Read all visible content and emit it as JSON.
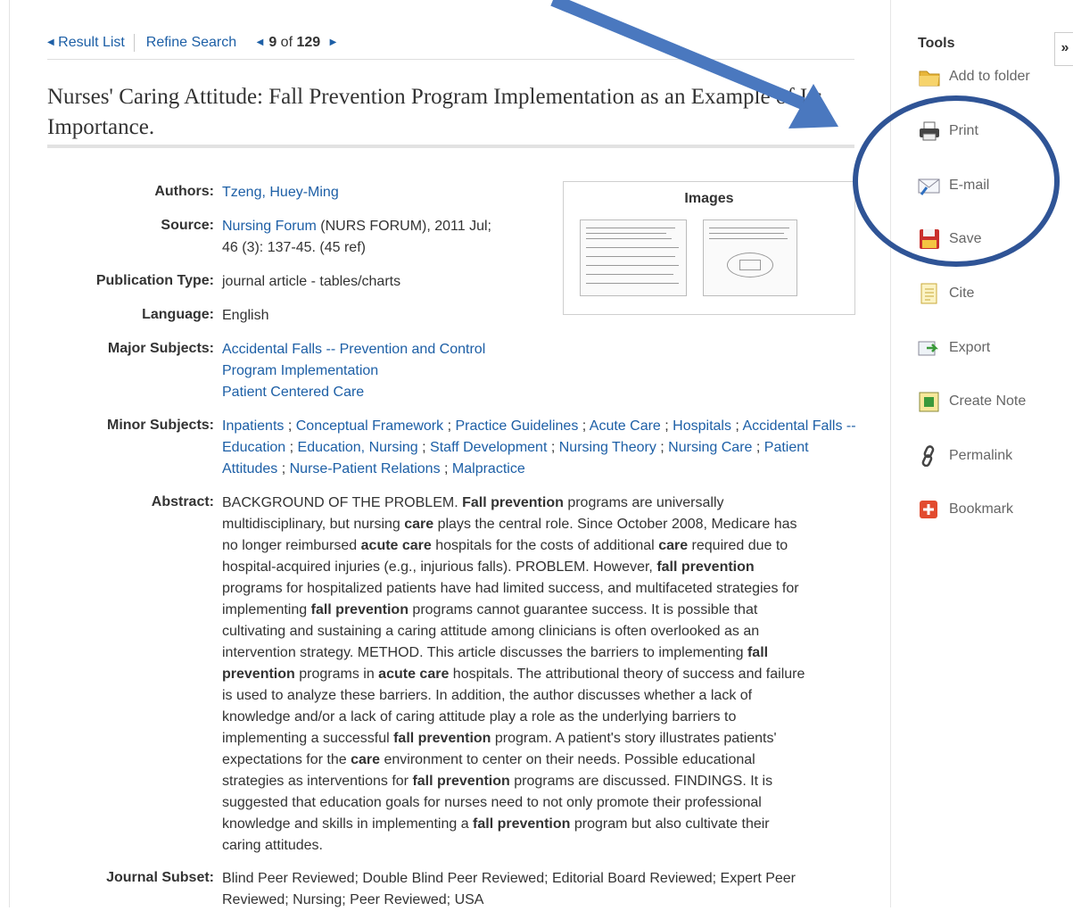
{
  "nav": {
    "result_list": "Result List",
    "refine_search": "Refine Search",
    "position": "9",
    "of_label": "of",
    "total": "129"
  },
  "article": {
    "title": "Nurses' Caring Attitude: Fall Prevention Program Implementation as an Example of Its Importance."
  },
  "fields": {
    "authors_label": "Authors:",
    "authors": "Tzeng, Huey-Ming",
    "source_label": "Source:",
    "source_link": "Nursing Forum",
    "source_rest": " (NURS FORUM), 2011 Jul;",
    "source_line2": "46 (3): 137-45. (45 ref)",
    "pubtype_label": "Publication Type:",
    "pubtype": "journal article - tables/charts",
    "language_label": "Language:",
    "language": "English",
    "major_label": "Major Subjects:",
    "major": [
      "Accidental Falls -- Prevention and Control",
      "Program Implementation",
      "Patient Centered Care"
    ],
    "minor_label": "Minor Subjects:",
    "minor": [
      "Inpatients",
      "Conceptual Framework",
      "Practice Guidelines",
      "Acute Care",
      "Hospitals",
      "Accidental Falls -- Education",
      "Education, Nursing",
      "Staff Development",
      "Nursing Theory",
      "Nursing Care",
      "Patient Attitudes",
      "Nurse-Patient Relations",
      "Malpractice"
    ],
    "abstract_label": "Abstract:",
    "journal_subset_label": "Journal Subset:",
    "journal_subset": "Blind Peer Reviewed; Double Blind Peer Reviewed; Editorial Board Reviewed; Expert Peer Reviewed; Nursing; Peer Reviewed; USA"
  },
  "abstract_lines": [
    [
      [
        "BACKGROUND OF THE PROBLEM. ",
        false
      ],
      [
        "Fall prevention",
        true
      ],
      [
        " programs are universally",
        false
      ]
    ],
    [
      [
        "multidisciplinary, but nursing ",
        false
      ],
      [
        "care",
        true
      ],
      [
        " plays the central role. Since October 2008, Medicare has",
        false
      ]
    ],
    [
      [
        "no longer reimbursed ",
        false
      ],
      [
        "acute care",
        true
      ],
      [
        " hospitals for the costs of additional ",
        false
      ],
      [
        "care",
        true
      ],
      [
        " required due to",
        false
      ]
    ],
    [
      [
        "hospital-acquired injuries (e.g., injurious falls). PROBLEM. However, ",
        false
      ],
      [
        "fall prevention",
        true
      ]
    ],
    [
      [
        "programs for hospitalized patients have had limited success, and multifaceted strategies for",
        false
      ]
    ],
    [
      [
        "implementing ",
        false
      ],
      [
        "fall prevention",
        true
      ],
      [
        " programs cannot guarantee success. It is possible that",
        false
      ]
    ],
    [
      [
        "cultivating and sustaining a caring attitude among clinicians is often overlooked as an",
        false
      ]
    ],
    [
      [
        "intervention strategy. METHOD. This article discusses the barriers to implementing ",
        false
      ],
      [
        "fall",
        true
      ]
    ],
    [
      [
        "prevention",
        true
      ],
      [
        " programs in ",
        false
      ],
      [
        "acute care",
        true
      ],
      [
        " hospitals. The attributional theory of success and failure",
        false
      ]
    ],
    [
      [
        "is used to analyze these barriers. In addition, the author discusses whether a lack of",
        false
      ]
    ],
    [
      [
        "knowledge and/or a lack of caring attitude play a role as the underlying barriers to",
        false
      ]
    ],
    [
      [
        "implementing a successful ",
        false
      ],
      [
        "fall prevention",
        true
      ],
      [
        " program. A patient's story illustrates patients'",
        false
      ]
    ],
    [
      [
        "expectations for the ",
        false
      ],
      [
        "care",
        true
      ],
      [
        " environment to center on their needs. Possible educational",
        false
      ]
    ],
    [
      [
        "strategies as interventions for ",
        false
      ],
      [
        "fall prevention",
        true
      ],
      [
        " programs are discussed. FINDINGS. It is",
        false
      ]
    ],
    [
      [
        "suggested that education goals for nurses need to not only promote their professional",
        false
      ]
    ],
    [
      [
        "knowledge and skills in implementing a ",
        false
      ],
      [
        "fall prevention",
        true
      ],
      [
        " program but also cultivate their",
        false
      ]
    ],
    [
      [
        "caring attitudes.",
        false
      ]
    ]
  ],
  "images": {
    "heading": "Images"
  },
  "tools": {
    "title": "Tools",
    "collapse": "»",
    "items": [
      "Add to folder",
      "Print",
      "E-mail",
      "Save",
      "Cite",
      "Export",
      "Create Note",
      "Permalink",
      "Bookmark"
    ]
  },
  "colors": {
    "link": "#1d5fa6",
    "annotation": "#2f5496",
    "arrow": "#4a78bf"
  }
}
